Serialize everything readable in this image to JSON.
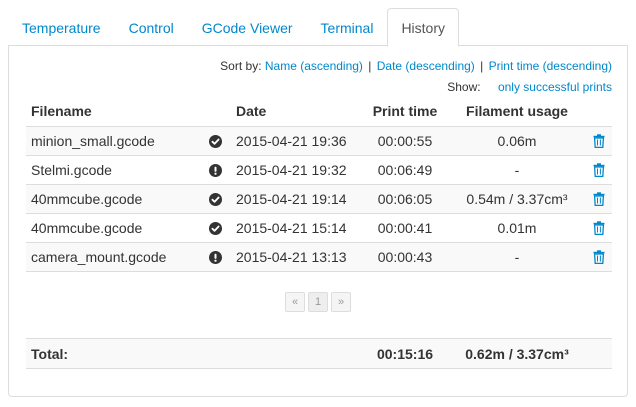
{
  "tabs": [
    {
      "label": "Temperature",
      "active": false
    },
    {
      "label": "Control",
      "active": false
    },
    {
      "label": "GCode Viewer",
      "active": false
    },
    {
      "label": "Terminal",
      "active": false
    },
    {
      "label": "History",
      "active": true
    }
  ],
  "sort": {
    "label": "Sort by:",
    "options": [
      "Name (ascending)",
      "Date (descending)",
      "Print time (descending)"
    ],
    "separator": "|"
  },
  "show": {
    "label": "Show:",
    "filter": "only successful prints"
  },
  "table": {
    "headers": {
      "filename": "Filename",
      "date": "Date",
      "print_time": "Print time",
      "filament": "Filament usage"
    },
    "rows": [
      {
        "filename": "minion_small.gcode",
        "status": "success",
        "status_icon": "check-circle-icon",
        "date": "2015-04-21 19:36",
        "print_time": "00:00:55",
        "filament": "0.06m"
      },
      {
        "filename": "Stelmi.gcode",
        "status": "failed",
        "status_icon": "exclamation-circle-icon",
        "date": "2015-04-21 19:32",
        "print_time": "00:06:49",
        "filament": "-"
      },
      {
        "filename": "40mmcube.gcode",
        "status": "success",
        "status_icon": "check-circle-icon",
        "date": "2015-04-21 19:14",
        "print_time": "00:06:05",
        "filament": "0.54m / 3.37cm³"
      },
      {
        "filename": "40mmcube.gcode",
        "status": "success",
        "status_icon": "check-circle-icon",
        "date": "2015-04-21 15:14",
        "print_time": "00:00:41",
        "filament": "0.01m"
      },
      {
        "filename": "camera_mount.gcode",
        "status": "failed",
        "status_icon": "exclamation-circle-icon",
        "date": "2015-04-21 13:13",
        "print_time": "00:00:43",
        "filament": "-"
      }
    ]
  },
  "pagination": {
    "prev": "«",
    "current": "1",
    "next": "»"
  },
  "total": {
    "label": "Total:",
    "print_time": "00:15:16",
    "filament": "0.62m / 3.37cm³"
  },
  "colors": {
    "link": "#0088cc",
    "text": "#333333",
    "border": "#dddddd",
    "trash": "#0088cc"
  }
}
